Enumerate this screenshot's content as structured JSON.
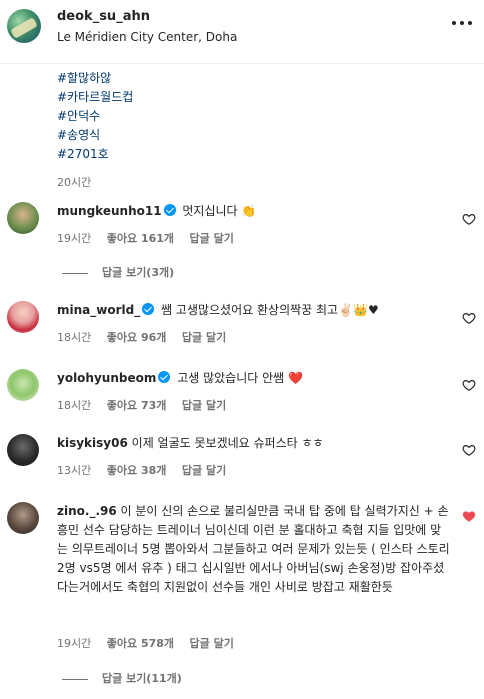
{
  "post": {
    "username": "deok_su_ahn",
    "location": "Le Méridien City Center, Doha"
  },
  "caption": {
    "hashtags": [
      "#할많하않",
      "#카타르월드컵",
      "#안덕수",
      "#송영식",
      "#2701호"
    ],
    "time": "20시간"
  },
  "comments": [
    {
      "username": "mungkeunho11",
      "verified": true,
      "text": "멋지십니다 👏",
      "time": "19시간",
      "likes": "좋아요 161개",
      "reply": "답글 달기",
      "view_replies": "답글 보기(3개)",
      "liked": false
    },
    {
      "username": "mina_world_",
      "verified": true,
      "text": "쌤 고생많으셨어요 환상의짝꿍 최고✌🏻👑♥",
      "time": "18시간",
      "likes": "좋아요 96개",
      "reply": "답글 달기",
      "liked": false
    },
    {
      "username": "yolohyunbeom",
      "verified": true,
      "text": "고생 많았습니다 안쌤 ❤️",
      "time": "18시간",
      "likes": "좋아요 73개",
      "reply": "답글 달기",
      "liked": false
    },
    {
      "username": "kisykisy06",
      "verified": false,
      "text": "이제 얼굴도 못보겠네요 슈퍼스타 ㅎㅎ",
      "time": "13시간",
      "likes": "좋아요 38개",
      "reply": "답글 달기",
      "liked": false
    },
    {
      "username": "zino._.96",
      "verified": false,
      "text": "이 분이 신의 손으로 불리실만큼 국내 탑 중에 탑 실력가지신 + 손흥민 선수 담당하는 트레이너 님이신데 이런 분 홀대하고 축협 지들 입맛에 맞는 의무트레이너 5명 뽑아와서 그분들하고 여러 문제가 있는듯 ( 인스타 스토리 2명 vs5명 에서 유추 ) 태그 십시일반 에서나 아버님(swj 손웅정)방 잡아주셨다는거에서도 축협의 지원없이 선수들 개인 사비로 방잡고 재활한듯",
      "time": "19시간",
      "likes": "좋아요 578개",
      "reply": "답글 달기",
      "view_replies": "답글 보기(11개)",
      "liked": true
    }
  ],
  "icons": {
    "heart_empty": "heart-outline-icon",
    "heart_filled": "heart-filled-icon",
    "more": "more-horizontal-icon"
  },
  "colors": {
    "hashtag": "#00376b",
    "verified": "#0095f6",
    "liked_heart": "#ed4956",
    "muted": "#737373"
  }
}
